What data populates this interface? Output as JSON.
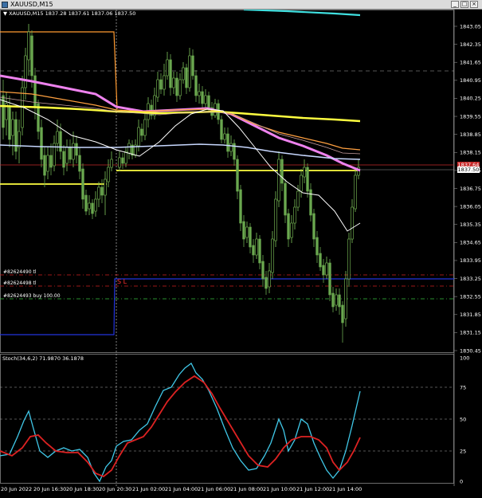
{
  "window": {
    "title": "XAUUSD,M15",
    "buttons": [
      "_",
      "□",
      "×"
    ]
  },
  "main_chart": {
    "symbol_line": "▼ XAUUSD,M15  1837.28 1837.61 1837.06 1837.50",
    "price_axis_labels": [
      "1843.05",
      "1842.35",
      "1841.65",
      "1840.95",
      "1840.25",
      "1839.55",
      "1838.85",
      "1838.15",
      "1837.45",
      "1836.75",
      "1836.05",
      "1835.35",
      "1834.65",
      "1833.95",
      "1833.25",
      "1832.55",
      "1831.85",
      "1831.15",
      "1830.45"
    ],
    "badges": {
      "red_price": "1837.64",
      "current_price": "1837.50"
    },
    "orders": [
      {
        "label": "#82624490 tl",
        "color": "#ff4d4d"
      },
      {
        "label": "#82624498 tl",
        "color": "#ff4d4d"
      },
      {
        "label": "#82624493 buy 100.00",
        "color": "#39d353"
      }
    ],
    "sl_label": "S L",
    "colors": {
      "bull_candle": "#7fc45a",
      "bear_candle": "#6aa84f",
      "ma_white": "#ffffff",
      "ma_pink": "#ee82ee",
      "ma_orange": "#ffa040",
      "ma_yellow": "#ffff40",
      "ma_lightblue": "#c8d8ff",
      "ma_cyan": "#40e0d0"
    }
  },
  "stoch_panel": {
    "label": "Stoch(34,6,2) 71.9870 36.1878",
    "axis_labels": [
      "100",
      "75",
      "50",
      "25",
      "0"
    ],
    "colors": {
      "main": "#40c8e8",
      "signal": "#dd2222"
    }
  },
  "time_axis_labels": [
    "20 Jun 2022",
    "20 Jun 16:30",
    "20 Jun 18:30",
    "20 Jun 20:30",
    "21 Jun 02:00",
    "21 Jun 04:00",
    "21 Jun 06:00",
    "21 Jun 08:00",
    "21 Jun 10:00",
    "21 Jun 12:00",
    "21 Jun 14:00"
  ]
}
